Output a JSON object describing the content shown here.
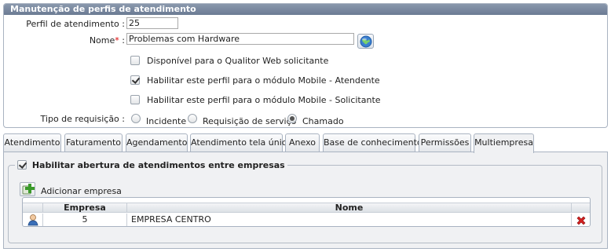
{
  "panel": {
    "title": "Manutenção de perfis de atendimento",
    "perfil_label": "Perfil de atendimento :",
    "perfil_value": "25",
    "nome_label": "Nome",
    "nome_required": "*",
    "nome_colon": ":",
    "nome_value": "Problemas com Hardware",
    "checkboxes": [
      {
        "label": "Disponível para o Qualitor Web solicitante",
        "checked": false
      },
      {
        "label": "Habilitar este perfil para o módulo Mobile - Atendente",
        "checked": true
      },
      {
        "label": "Habilitar este perfil para o módulo Mobile - Solicitante",
        "checked": false
      }
    ],
    "tipo_label": "Tipo de requisição :",
    "tipo_options": [
      {
        "label": "Incidente",
        "selected": false
      },
      {
        "label": "Requisição de serviço",
        "selected": false
      },
      {
        "label": "Chamado",
        "selected": true
      }
    ]
  },
  "tabs": [
    {
      "label": "Atendimento",
      "active": false
    },
    {
      "label": "Faturamento",
      "active": false
    },
    {
      "label": "Agendamento",
      "active": false
    },
    {
      "label": "Atendimento tela única",
      "active": false
    },
    {
      "label": "Anexo",
      "active": false
    },
    {
      "label": "Base de conhecimento",
      "active": false
    },
    {
      "label": "Permissões",
      "active": false
    },
    {
      "label": "Multiempresa",
      "active": true
    }
  ],
  "multiempresa": {
    "enable_label": "Habilitar abertura de atendimentos entre empresas",
    "enable_checked": true,
    "add_label": "Adicionar empresa",
    "grid": {
      "columns": [
        "Empresa",
        "Nome"
      ],
      "rows": [
        {
          "empresa": "5",
          "nome": "EMPRESA CENTRO"
        }
      ]
    }
  },
  "colors": {
    "header": "#6b7b93",
    "delete": "#d42020",
    "add": "#3a9a2a"
  }
}
